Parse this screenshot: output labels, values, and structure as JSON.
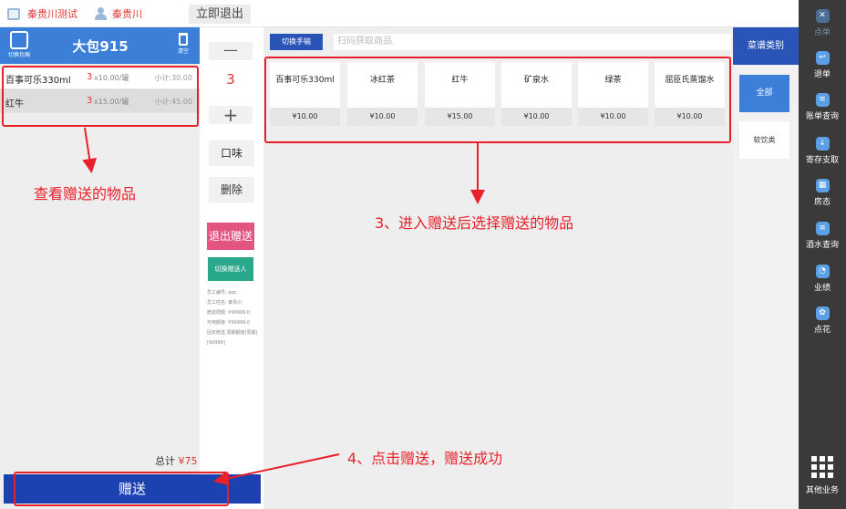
{
  "topbar": {
    "store": "秦贵川测试",
    "user": "秦贵川",
    "exit_label": "立即退出"
  },
  "left": {
    "switch_label": "切换包厢",
    "room_title": "大包915",
    "clear_label": "清空",
    "orders": [
      {
        "name": "百事可乐330ml",
        "qty": "3",
        "price": "x10.00/罐",
        "subtotal": "小计:30.00"
      },
      {
        "name": "红牛",
        "qty": "3",
        "price": "x15.00/罐",
        "subtotal": "小计:45.00"
      }
    ],
    "total_label": "总计",
    "total_value": "¥75"
  },
  "gift_button": "赠送",
  "middle": {
    "minus": "—",
    "qty": "3",
    "plus": "+",
    "flavor": "口味",
    "delete": "删除",
    "exit_gift": "退出赠送",
    "switch_gifter": "切换赠送人",
    "info": [
      "员工编号: qqc",
      "员工姓名: 秦贵川",
      "赠送限额: ¥99999.0",
      "可用额度: ¥99999.0",
      "固定赠送,周期额度[周期][99999]"
    ]
  },
  "catalog": {
    "scan_button": "切换手输",
    "scan_placeholder": "扫码获取商品.",
    "products": [
      {
        "name": "百事可乐330ml",
        "price": "¥10.00"
      },
      {
        "name": "冰红茶",
        "price": "¥10.00"
      },
      {
        "name": "红牛",
        "price": "¥15.00"
      },
      {
        "name": "矿泉水",
        "price": "¥10.00"
      },
      {
        "name": "绿茶",
        "price": "¥10.00"
      },
      {
        "name": "屈臣氏蒸馏水",
        "price": "¥10.00"
      }
    ]
  },
  "categories": {
    "header": "菜谱类别",
    "all": "全部",
    "soft": "软饮类"
  },
  "sidebar": {
    "items": [
      {
        "label": "点单",
        "icon": "fork-icon"
      },
      {
        "label": "退单",
        "icon": "return-icon"
      },
      {
        "label": "账单查询",
        "icon": "bill-icon"
      },
      {
        "label": "寄存支取",
        "icon": "storage-icon"
      },
      {
        "label": "房态",
        "icon": "room-icon"
      },
      {
        "label": "酒水查询",
        "icon": "drink-icon"
      },
      {
        "label": "业绩",
        "icon": "chart-icon"
      },
      {
        "label": "点花",
        "icon": "flower-icon"
      }
    ],
    "more": "其他业务"
  },
  "annotations": {
    "view": "查看赠送的物品",
    "select": "3、进入赠送后选择赠送的物品",
    "click": "4、点击赠送，赠送成功"
  },
  "colors": {
    "primary": "#3b7fd9",
    "dark_blue": "#1c41b0",
    "annotation_red": "#e8202a",
    "pink": "#e45480",
    "teal": "#2aa88b"
  }
}
